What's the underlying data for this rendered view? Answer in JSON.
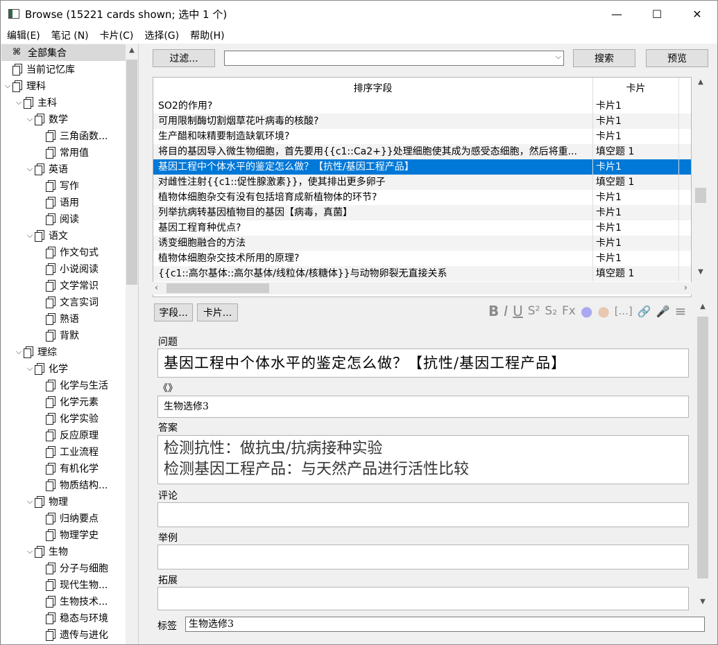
{
  "window": {
    "title": "Browse (15221 cards shown; 选中 1 个)",
    "minimize": "—",
    "maximize": "☐",
    "close": "✕"
  },
  "menu": [
    "编辑(E)",
    "笔记 (N)",
    "卡片(C)",
    "选择(G)",
    "帮助(H)"
  ],
  "sidebar": {
    "items": [
      {
        "label": "全部集合",
        "level": 0,
        "arrow": "",
        "icon": "all-icon",
        "selected": true
      },
      {
        "label": "当前记忆库",
        "level": 0,
        "arrow": "",
        "icon": "deck-icon"
      },
      {
        "label": "理科",
        "level": 0,
        "arrow": "⌵",
        "icon": "deck-icon"
      },
      {
        "label": "主科",
        "level": 1,
        "arrow": "⌵",
        "icon": "deck-icon"
      },
      {
        "label": "数学",
        "level": 2,
        "arrow": "⌵",
        "icon": "deck-icon"
      },
      {
        "label": "三角函数...",
        "level": 3,
        "arrow": "",
        "icon": "deck-icon"
      },
      {
        "label": "常用值",
        "level": 3,
        "arrow": "",
        "icon": "deck-icon"
      },
      {
        "label": "英语",
        "level": 2,
        "arrow": "⌵",
        "icon": "deck-icon"
      },
      {
        "label": "写作",
        "level": 3,
        "arrow": "",
        "icon": "deck-icon"
      },
      {
        "label": "语用",
        "level": 3,
        "arrow": "",
        "icon": "deck-icon"
      },
      {
        "label": "阅读",
        "level": 3,
        "arrow": "",
        "icon": "deck-icon"
      },
      {
        "label": "语文",
        "level": 2,
        "arrow": "⌵",
        "icon": "deck-icon"
      },
      {
        "label": "作文句式",
        "level": 3,
        "arrow": "",
        "icon": "deck-icon"
      },
      {
        "label": "小说阅读",
        "level": 3,
        "arrow": "",
        "icon": "deck-icon"
      },
      {
        "label": "文学常识",
        "level": 3,
        "arrow": "",
        "icon": "deck-icon"
      },
      {
        "label": "文言实词",
        "level": 3,
        "arrow": "",
        "icon": "deck-icon"
      },
      {
        "label": "熟语",
        "level": 3,
        "arrow": "",
        "icon": "deck-icon"
      },
      {
        "label": "背默",
        "level": 3,
        "arrow": "",
        "icon": "deck-icon"
      },
      {
        "label": "理综",
        "level": 1,
        "arrow": "⌵",
        "icon": "deck-icon"
      },
      {
        "label": "化学",
        "level": 2,
        "arrow": "⌵",
        "icon": "deck-icon"
      },
      {
        "label": "化学与生活",
        "level": 3,
        "arrow": "",
        "icon": "deck-icon"
      },
      {
        "label": "化学元素",
        "level": 3,
        "arrow": "",
        "icon": "deck-icon"
      },
      {
        "label": "化学实验",
        "level": 3,
        "arrow": "",
        "icon": "deck-icon"
      },
      {
        "label": "反应原理",
        "level": 3,
        "arrow": "",
        "icon": "deck-icon"
      },
      {
        "label": "工业流程",
        "level": 3,
        "arrow": "",
        "icon": "deck-icon"
      },
      {
        "label": "有机化学",
        "level": 3,
        "arrow": "",
        "icon": "deck-icon"
      },
      {
        "label": "物质结构...",
        "level": 3,
        "arrow": "",
        "icon": "deck-icon"
      },
      {
        "label": "物理",
        "level": 2,
        "arrow": "⌵",
        "icon": "deck-icon"
      },
      {
        "label": "归纳要点",
        "level": 3,
        "arrow": "",
        "icon": "deck-icon"
      },
      {
        "label": "物理学史",
        "level": 3,
        "arrow": "",
        "icon": "deck-icon"
      },
      {
        "label": "生物",
        "level": 2,
        "arrow": "⌵",
        "icon": "deck-icon"
      },
      {
        "label": "分子与细胞",
        "level": 3,
        "arrow": "",
        "icon": "deck-icon"
      },
      {
        "label": "现代生物...",
        "level": 3,
        "arrow": "",
        "icon": "deck-icon"
      },
      {
        "label": "生物技术...",
        "level": 3,
        "arrow": "",
        "icon": "deck-icon"
      },
      {
        "label": "稳态与环境",
        "level": 3,
        "arrow": "",
        "icon": "deck-icon"
      },
      {
        "label": "遗传与进化",
        "level": 3,
        "arrow": "",
        "icon": "deck-icon"
      }
    ]
  },
  "toolbar": {
    "filter_label": "过滤...",
    "search_value": "",
    "search_label": "搜索",
    "preview_label": "预览"
  },
  "table": {
    "columns": [
      "排序字段",
      "卡片"
    ],
    "rows": [
      {
        "sort": "SO2的作用?",
        "card": "卡片1"
      },
      {
        "sort": "可用限制酶切割烟草花叶病毒的核酸?",
        "card": "卡片1"
      },
      {
        "sort": "生产醋和味精要制造缺氧环境?",
        "card": "卡片1"
      },
      {
        "sort": "将目的基因导入微生物细胞，首先要用{{c1::Ca2+}}处理细胞使其成为感受态细胞，然后将重...",
        "card": "填空题 1"
      },
      {
        "sort": "基因工程中个体水平的鉴定怎么做？【抗性/基因工程产品】",
        "card": "卡片1",
        "selected": true
      },
      {
        "sort": "对雌性注射{{c1::促性腺激素}}，使其排出更多卵子",
        "card": "填空题 1"
      },
      {
        "sort": "植物体细胞杂交有没有包括培育成新植物体的环节?",
        "card": "卡片1"
      },
      {
        "sort": "列举抗病转基因植物目的基因【病毒，真菌】",
        "card": "卡片1"
      },
      {
        "sort": "基因工程育种优点?",
        "card": "卡片1"
      },
      {
        "sort": "诱变细胞融合的方法",
        "card": "卡片1"
      },
      {
        "sort": "植物体细胞杂交技术所用的原理?",
        "card": "卡片1"
      },
      {
        "sort": "{{c1::高尔基体::高尔基体/线粒体/核糖体}}与动物卵裂无直接关系",
        "card": "填空题 1"
      }
    ]
  },
  "editor": {
    "fields_button": "字段...",
    "cards_button": "卡片...",
    "format_icons": [
      "B",
      "I",
      "U",
      "S²",
      "S₂",
      "Fx",
      "●",
      "●",
      "[...]",
      "🔗",
      "🎤",
      "≡"
    ],
    "fields": [
      {
        "label": "问题",
        "value": "基因工程中个体水平的鉴定怎么做？【抗性/基因工程产品】"
      },
      {
        "label": "《》",
        "value": "生物选修3"
      },
      {
        "label": "答案",
        "value": "检测抗性：做抗虫/抗病接种实验\n检测基因工程产品：与天然产品进行活性比较"
      },
      {
        "label": "评论",
        "value": ""
      },
      {
        "label": "举例",
        "value": ""
      },
      {
        "label": "拓展",
        "value": ""
      }
    ],
    "tags_label": "标签",
    "tags_value": "生物选修3"
  },
  "colors": {
    "selection": "#0078d7",
    "sidebar_selected": "#d9d9d9",
    "background": "#f0f0f0"
  }
}
